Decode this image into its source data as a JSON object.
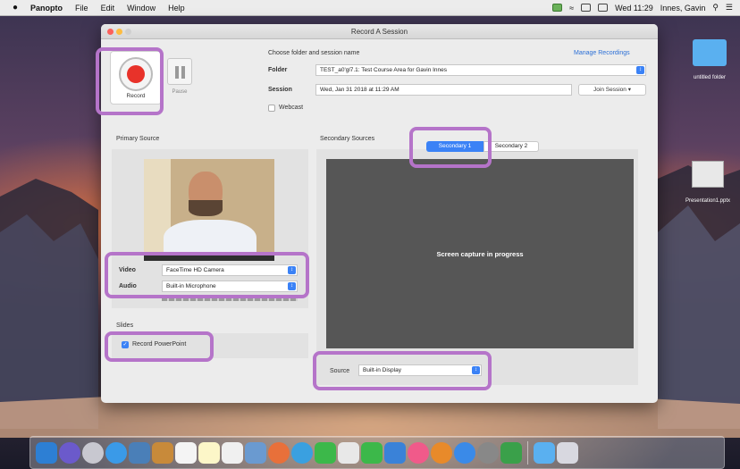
{
  "menubar": {
    "app": "Panopto",
    "items": [
      "File",
      "Edit",
      "Window",
      "Help"
    ],
    "clock": "Wed 11:29",
    "user": "Innes, Gavin"
  },
  "window": {
    "title": "Record A Session"
  },
  "controls": {
    "record_label": "Record",
    "pause_label": "Pause"
  },
  "session": {
    "heading": "Choose folder and session name",
    "manage_link": "Manage Recordings",
    "folder_label": "Folder",
    "folder_value": "TEST_a0'gl7.1: Test Course Area for Gavin Innes",
    "session_label": "Session",
    "session_value": "Wed, Jan 31 2018 at 11:29 AM",
    "join_button": "Join Session",
    "webcast_label": "Webcast"
  },
  "primary": {
    "heading": "Primary Source",
    "video_label": "Video",
    "video_value": "FaceTime HD Camera",
    "audio_label": "Audio",
    "audio_value": "Built-in Microphone"
  },
  "slides": {
    "heading": "Slides",
    "record_ppt_label": "Record PowerPoint"
  },
  "secondary": {
    "heading": "Secondary Sources",
    "tabs": [
      "Secondary 1",
      "Secondary 2"
    ],
    "capture_text": "Screen capture in progress",
    "source_label": "Source",
    "source_value": "Built-in Display"
  },
  "desktop": {
    "items": [
      "untitled folder",
      "Presentation1.pptx"
    ]
  },
  "colors": {
    "highlight": "#b574c9",
    "record_red": "#e8322a",
    "accent_blue": "#3b82f6"
  }
}
